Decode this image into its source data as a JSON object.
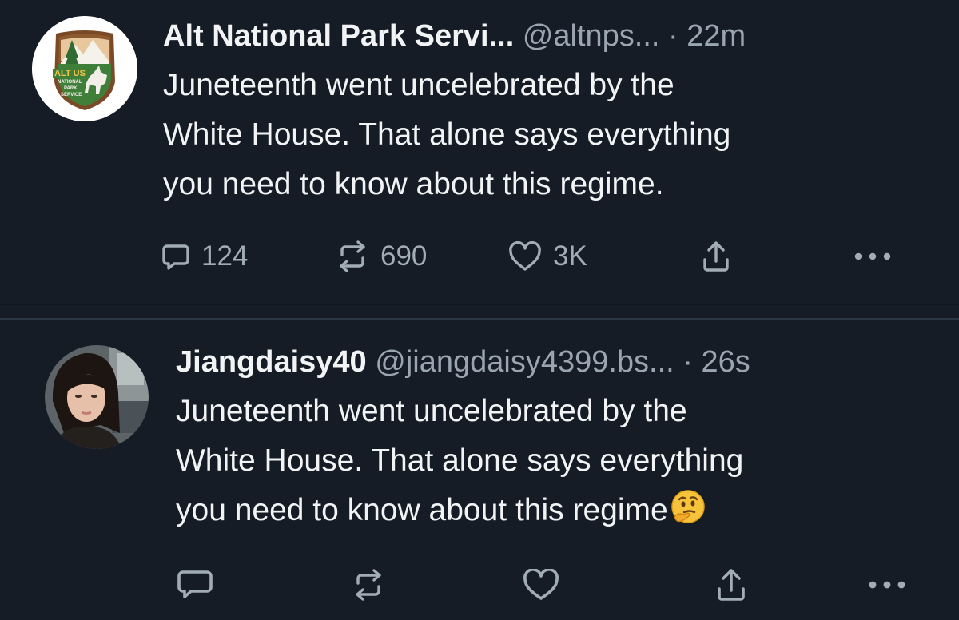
{
  "posts": [
    {
      "display_name": "Alt National Park Servi...",
      "handle": "@altnps...",
      "separator": "·",
      "time": "22m",
      "text_lines": [
        "Juneteenth went uncelebrated by the",
        "White House. That alone says everything",
        "you need to know about this regime."
      ],
      "reply_count": "124",
      "repost_count": "690",
      "like_count": "3K",
      "avatar_icon": "alt-us-national-park-service-logo",
      "logo_text": {
        "top": "ALT US",
        "line1": "NATIONAL",
        "line2": "PARK",
        "line3": "SERVICE"
      }
    },
    {
      "display_name": "Jiangdaisy40",
      "handle": "@jiangdaisy4399.bs...",
      "separator": "·",
      "time": "26s",
      "text_lines": [
        "Juneteenth went uncelebrated by the",
        "White House. That alone says everything",
        "you need to know about this regime"
      ],
      "emoji": "thinking-face",
      "reply_count": "",
      "repost_count": "",
      "like_count": "",
      "avatar_icon": "profile-photo-woman"
    }
  ],
  "icons": {
    "reply": "reply-icon",
    "repost": "repost-icon",
    "like": "heart-icon",
    "share": "share-icon",
    "more": "more-icon"
  },
  "colors": {
    "background": "#151c25",
    "text": "#f1f3f5",
    "muted": "#9aa5b1",
    "divider": "#2b3744"
  }
}
